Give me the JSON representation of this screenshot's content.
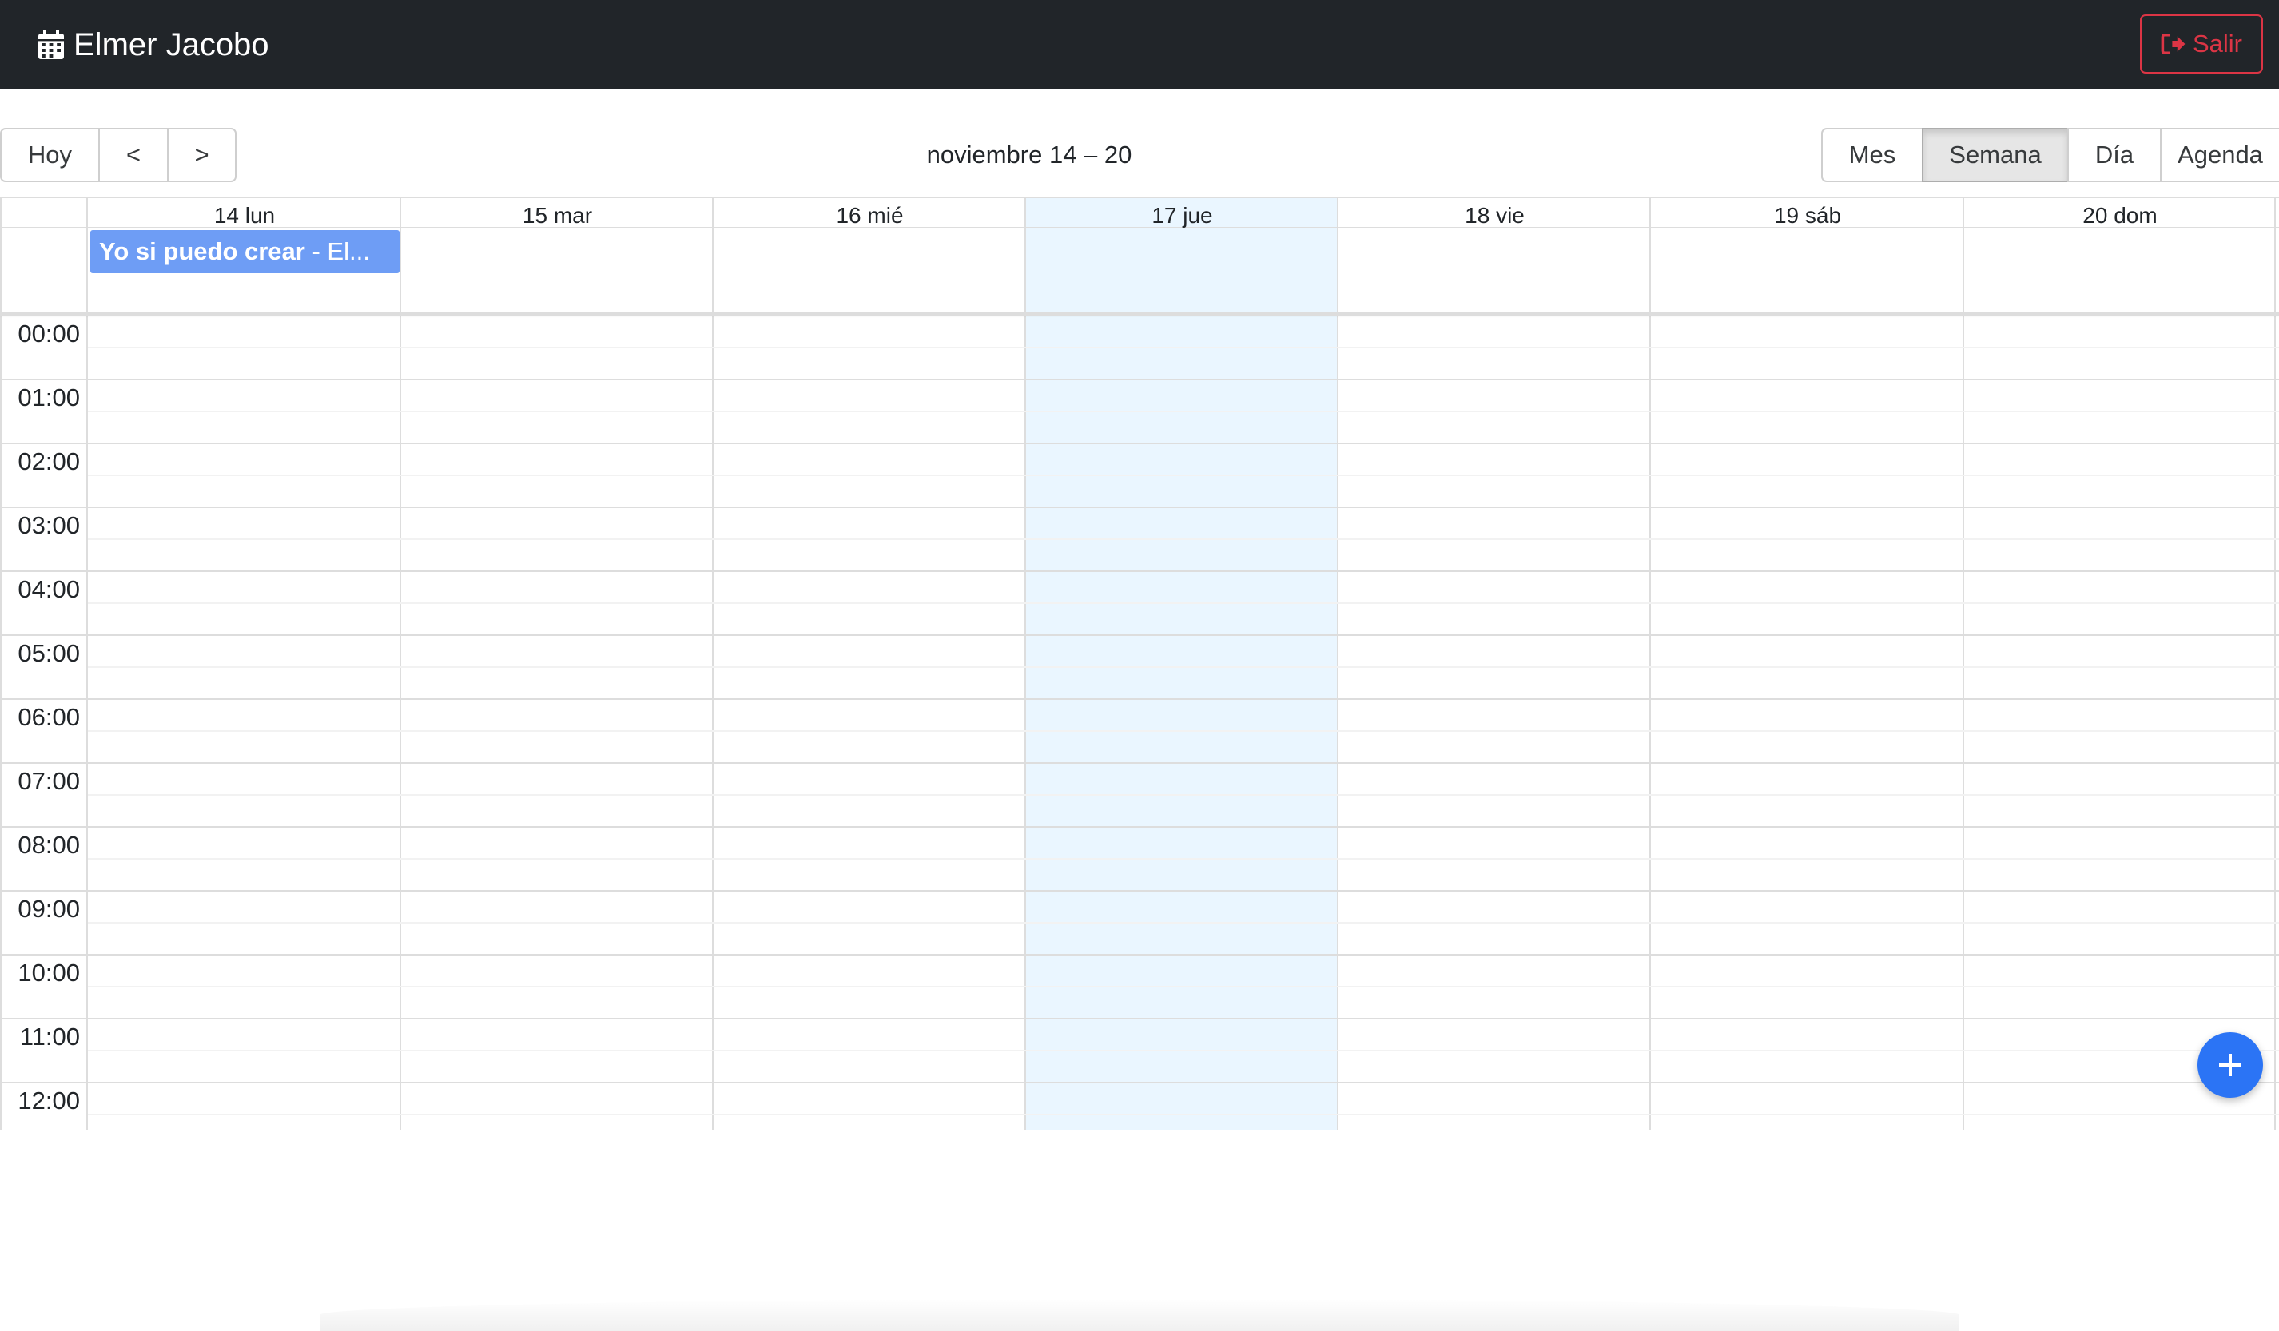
{
  "navbar": {
    "icon": "calendar-icon",
    "user_name": "Elmer Jacobo",
    "logout_icon": "sign-out-icon",
    "logout_label": "Salir",
    "logout_color": "#dc3545",
    "background": "#212529"
  },
  "toolbar": {
    "nav_buttons": [
      "Hoy",
      "<",
      ">"
    ],
    "range_label": "noviembre 14 – 20",
    "view_buttons": [
      "Mes",
      "Semana",
      "Día",
      "Agenda"
    ],
    "active_view": "Semana"
  },
  "week": {
    "days": [
      "14 lun",
      "15 mar",
      "16 mié",
      "17 jue",
      "18 vie",
      "19 sáb",
      "20 dom"
    ],
    "today": "17 jue",
    "today_color": "#eaf6ff"
  },
  "events": [
    {
      "title": "Yo si puedo crear",
      "user": "- El...",
      "day": "14 lun",
      "all_day": true,
      "color": "#6e9df5"
    }
  ],
  "times": [
    "00:00",
    "01:00",
    "02:00",
    "03:00",
    "04:00",
    "05:00",
    "06:00",
    "07:00",
    "08:00",
    "09:00",
    "10:00",
    "11:00",
    "12:00"
  ],
  "fab": {
    "icon": "plus-icon",
    "color": "#2b74f5"
  }
}
